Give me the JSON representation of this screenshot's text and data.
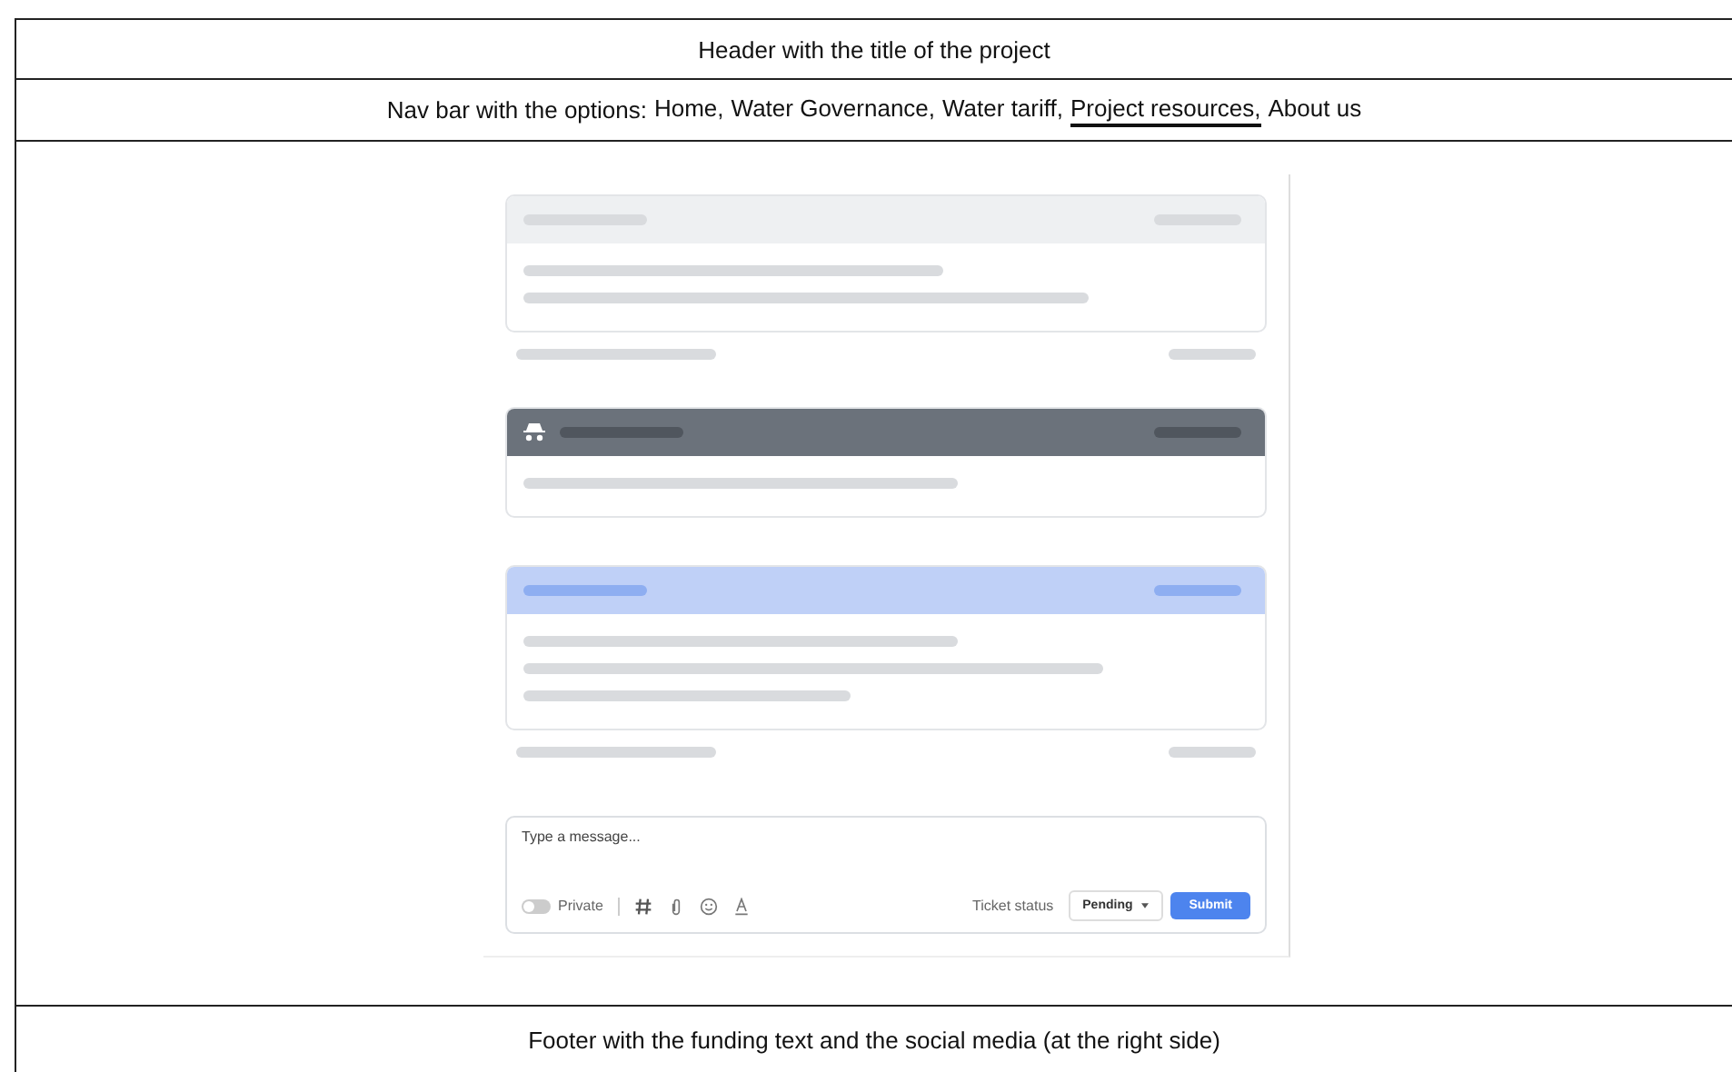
{
  "header": {
    "title": "Header with the title of the project"
  },
  "nav": {
    "prefix": "Nav bar with the options:",
    "options": [
      {
        "label": "Home,",
        "selected": false
      },
      {
        "label": "Water Governance,",
        "selected": false
      },
      {
        "label": "Water tariff,",
        "selected": false
      },
      {
        "label": "Project resources,",
        "selected": true
      },
      {
        "label": "About us",
        "selected": false
      }
    ]
  },
  "cards": [
    {
      "kind": "plain",
      "meta": true
    },
    {
      "kind": "private",
      "meta": false
    },
    {
      "kind": "highlighted",
      "meta": true
    }
  ],
  "composer": {
    "placeholder": "Type a message...",
    "private": {
      "label": "Private",
      "on": false
    },
    "status_label": "Ticket status",
    "status": "Pending",
    "submit": "Submit"
  },
  "footer": {
    "text": "Footer with the funding text and the social media (at the right side)"
  }
}
